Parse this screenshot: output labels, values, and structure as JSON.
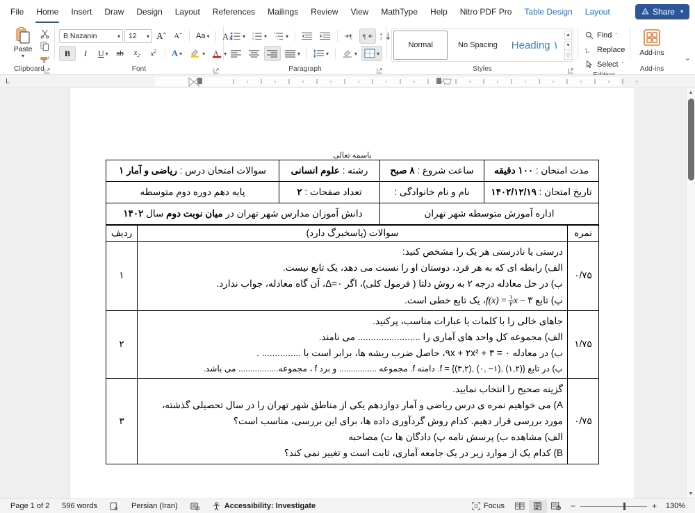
{
  "window": {
    "title": "Microsoft Word"
  },
  "tabs": [
    {
      "label": "File",
      "state": "normal",
      "name": "tab-file"
    },
    {
      "label": "Home",
      "state": "active",
      "name": "tab-home"
    },
    {
      "label": "Insert",
      "state": "normal",
      "name": "tab-insert"
    },
    {
      "label": "Draw",
      "state": "normal",
      "name": "tab-draw"
    },
    {
      "label": "Design",
      "state": "normal",
      "name": "tab-design"
    },
    {
      "label": "Layout",
      "state": "normal",
      "name": "tab-layout"
    },
    {
      "label": "References",
      "state": "normal",
      "name": "tab-references"
    },
    {
      "label": "Mailings",
      "state": "normal",
      "name": "tab-mailings"
    },
    {
      "label": "Review",
      "state": "normal",
      "name": "tab-review"
    },
    {
      "label": "View",
      "state": "normal",
      "name": "tab-view"
    },
    {
      "label": "MathType",
      "state": "normal",
      "name": "tab-mathtype"
    },
    {
      "label": "Help",
      "state": "normal",
      "name": "tab-help"
    },
    {
      "label": "Nitro PDF Pro",
      "state": "normal",
      "name": "tab-nitro-pdf-pro"
    },
    {
      "label": "Table Design",
      "state": "contextual",
      "name": "tab-table-design"
    },
    {
      "label": "Layout",
      "state": "contextual",
      "name": "tab-table-layout"
    }
  ],
  "share": {
    "label": "Share",
    "caret": "▾",
    "color": "#2b579a"
  },
  "ribbon": {
    "clipboard": {
      "group_label": "Clipboard",
      "paste_label": "Paste",
      "paste_caret": "▾",
      "cut_icon": "scissors-icon",
      "copy_icon": "copy-icon",
      "format_painter_icon": "format-painter-icon",
      "dialog_launcher": "⬌"
    },
    "font": {
      "group_label": "Font",
      "font_name": "B Nazanin",
      "font_size": "12",
      "grow_font": "Aˆ",
      "shrink_font": "Aˇ",
      "change_case": "Aa",
      "clear_formatting": "A",
      "bold": "B",
      "italic": "I",
      "underline": "U",
      "strikethrough": "ab",
      "subscript": "x",
      "superscript": "x",
      "text_effects": "A",
      "highlight": "highlight-icon",
      "font_color": "A",
      "dialog_launcher": "⬌"
    },
    "paragraph": {
      "group_label": "Paragraph",
      "bullets": "bullets-icon",
      "numbering": "numbering-icon",
      "multilevel": "multilevel-list-icon",
      "decrease_indent": "decrease-indent-icon",
      "increase_indent": "increase-indent-icon",
      "ltr": "left-to-right-icon",
      "rtl": "right-to-left-icon",
      "sort": "sort-icon",
      "show_marks": "¶",
      "align_left": "align-left-icon",
      "align_center": "align-center-icon",
      "align_right": "align-right-icon",
      "justify": "justify-icon",
      "line_spacing": "line-spacing-icon",
      "shading": "shading-icon",
      "borders": "borders-icon",
      "dialog_launcher": "⬌"
    },
    "styles": {
      "group_label": "Styles",
      "items": [
        {
          "label": "Normal",
          "selected": true
        },
        {
          "label": "No Spacing",
          "selected": false
        },
        {
          "label": "Heading ۱",
          "selected": false
        }
      ],
      "scroll_up": "▲",
      "scroll_down": "▼",
      "more": "⬇",
      "dialog_launcher": "⬌"
    },
    "editing": {
      "group_label": "Editing",
      "find": "Find",
      "find_caret": "ˇ",
      "replace": "Replace",
      "select": "Select",
      "select_caret": "ˇ"
    },
    "addins": {
      "group_label": "Add-ins",
      "label": "Add-ins"
    },
    "collapse": "⌄"
  },
  "ruler": {
    "tab_selector": "L"
  },
  "document": {
    "basmalah": "باسمه تعالی",
    "header_table": [
      [
        {
          "text": "سوالات امتحان درس : ",
          "bold_text": "ریاضی و آمار ۱"
        },
        {
          "text": "رشته : ",
          "bold_text": "علوم انسانی"
        },
        {
          "text": "ساعت شروع : ",
          "bold_text": "۸ صبح"
        },
        {
          "text": "مدت امتحان : ",
          "bold_text": "۱۰۰ دقیقه"
        }
      ],
      [
        {
          "text": "پایه دهم دوره دوم متوسطه",
          "bold_text": ""
        },
        {
          "text": "تعداد صفحات : ",
          "bold_text": "۲"
        },
        {
          "text": "نام و نام خانوادگی : ",
          "bold_text": ""
        },
        {
          "text": "تاریخ امتحان : ",
          "bold_text": "۱۴۰۲/۱۲/۱۹"
        }
      ]
    ],
    "header_row3": {
      "left": "اداره آموزش متوسطه شهر تهران",
      "right_pre": "دانش آموزان مدارس شهر تهران در ",
      "right_bold": "میان نوبت دوم",
      "right_post": " سال ",
      "right_bold2": "۱۴۰۲"
    },
    "q_headers": {
      "radif": "ردیف",
      "soal": "سوالات (پاسخبرگ دارد)",
      "nomre": "نمره"
    },
    "questions": [
      {
        "number": "۱",
        "score": "۰/۷۵",
        "lines": [
          "درستی یا نادرستی هر یک را  مشخص کنید:",
          "الف) رابطه ای که به هر فرد، دوستان او را نسبت می دهد، یک تابع نیست.",
          "ب) در حل معادله درجه ۲ به روش دلتا ( فرمول کلی)، اگر ۰=Δ، آن گاه معادله، جواب ندارد."
        ],
        "math_line": {
          "prefix": "پ) تابع ",
          "suffix": "، یک تابع خطی است.",
          "fn": "f(x)",
          "eq": "=",
          "frac_num": "۱",
          "frac_den": "۲",
          "var": "x",
          "minus": "−",
          "const": "۳"
        }
      },
      {
        "number": "۲",
        "score": "۱/۷۵",
        "lines": [
          "جاهای خالی را با کلمات یا عبارات مناسب، پرکنید.",
          "الف) مجموعه کل واحد های آماری را ........................  می نامند.",
          "ب) در معادله ۰ = ۳ + ۹x + ۲x²، حاصل ضرب ریشه ها، برابر است با ............... .",
          "پ) در تابع f = {(۳,۲), (۰, −۱), (۱,۲)}. دامنه f. مجموعه ................ و برد f ، مجموعه................. می باشد."
        ]
      },
      {
        "number": "۳",
        "score": "۰/۷۵",
        "lines": [
          "گزینه صحیح را انتخاب نمایید.",
          "A) می خواهیم نمره ی درس ریاضی و آمار دوازدهم یکی از مناطق شهر تهران را در سال تحصیلی گذشته،",
          "مورد بررسی قرار دهیم. کدام روش گردآوری داده ها، برای این بررسی، مناسب است؟"
        ],
        "options": [
          "الف) مشاهده",
          "ب) پرسش نامه",
          "پ) دادگان ها",
          "ت) مصاحبه"
        ],
        "last_line": "B) کدام یک از موارد زیر در یک جامعه آماری، ثابت است و تغییر نمی کند؟"
      }
    ]
  },
  "statusbar": {
    "page": "Page 1 of 2",
    "words": "596 words",
    "proofing_icon": "proofing-errors-icon",
    "language": "Persian (Iran)",
    "track_changes_icon": "track-changes-icon",
    "accessibility": "Accessibility: Investigate",
    "focus": "Focus",
    "view_read": "read-mode-icon",
    "view_print": "print-layout-icon",
    "view_web": "web-layout-icon",
    "zoom_out": "−",
    "zoom_in": "+",
    "zoom_level": "130%"
  }
}
